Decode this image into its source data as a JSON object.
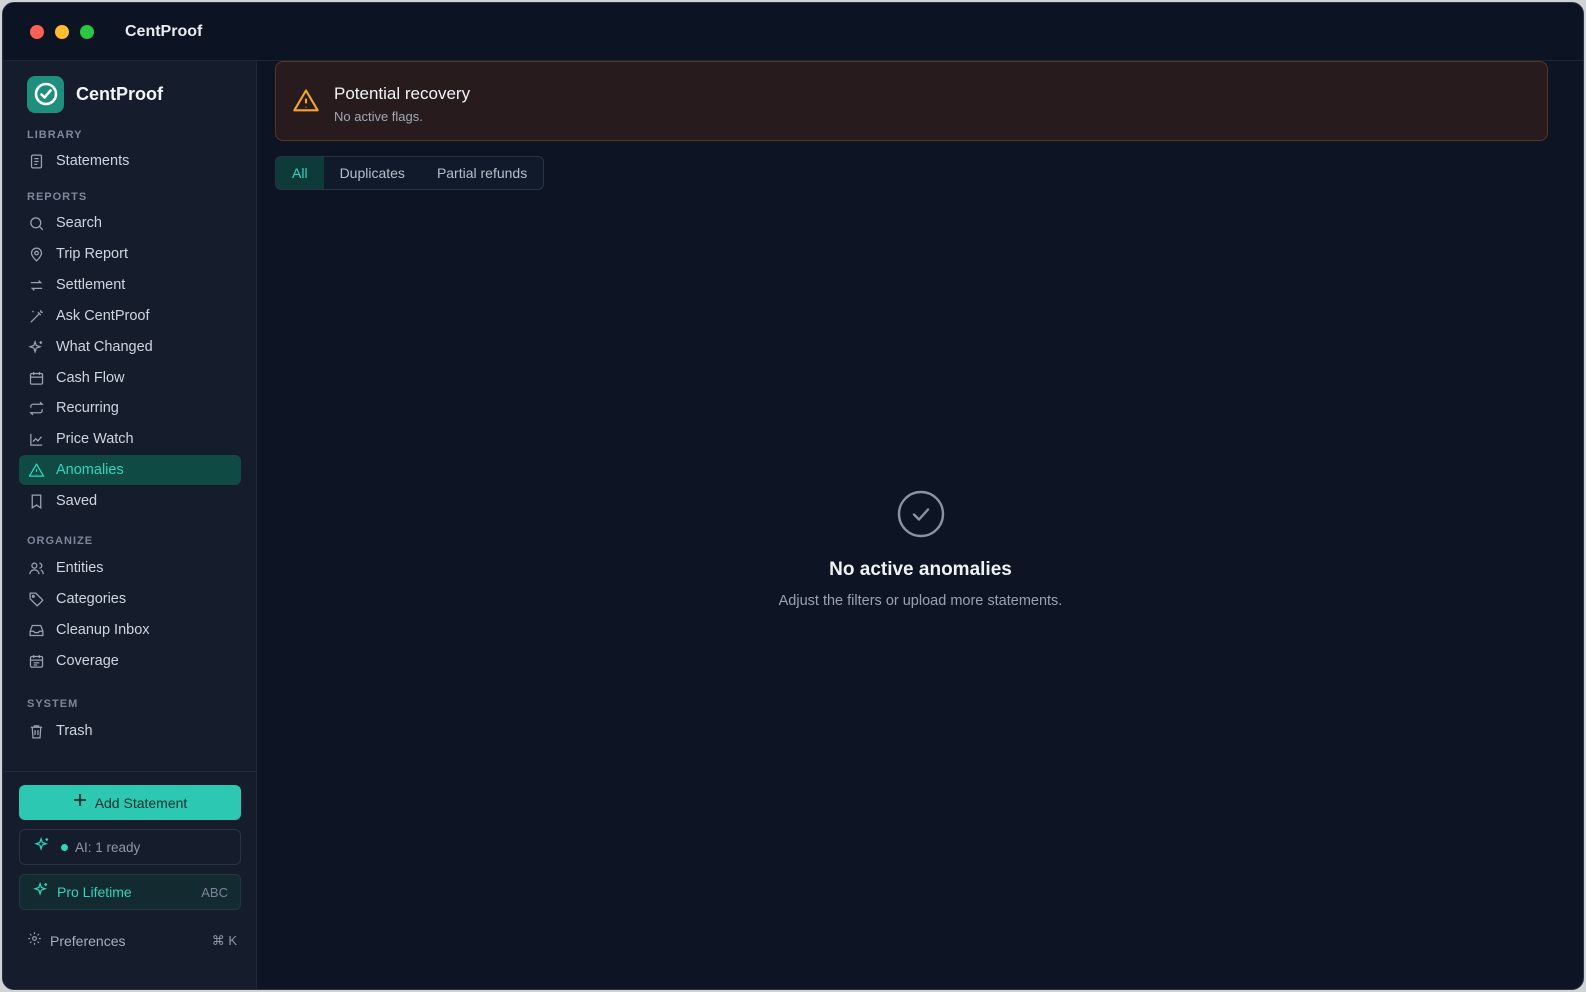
{
  "app": {
    "window_title": "CentProof",
    "brand_name": "CentProof"
  },
  "sidebar": {
    "sections": {
      "library": "LIBRARY",
      "reports": "REPORTS",
      "organize": "ORGANIZE",
      "system": "SYSTEM"
    },
    "items": [
      {
        "label": "Statements",
        "icon": "document-icon"
      },
      {
        "label": "Search",
        "icon": "search-icon"
      },
      {
        "label": "Trip Report",
        "icon": "map-pin-icon"
      },
      {
        "label": "Settlement",
        "icon": "arrows-swap-icon"
      },
      {
        "label": "Ask CentProof",
        "icon": "magic-wand-icon"
      },
      {
        "label": "What Changed",
        "icon": "sparkles-icon"
      },
      {
        "label": "Cash Flow",
        "icon": "calendar-icon"
      },
      {
        "label": "Recurring",
        "icon": "repeat-icon"
      },
      {
        "label": "Price Watch",
        "icon": "line-chart-icon"
      },
      {
        "label": "Anomalies",
        "icon": "warning-icon",
        "active": true
      },
      {
        "label": "Saved",
        "icon": "bookmark-icon"
      },
      {
        "label": "Entities",
        "icon": "users-icon"
      },
      {
        "label": "Categories",
        "icon": "tag-icon"
      },
      {
        "label": "Cleanup Inbox",
        "icon": "inbox-icon"
      },
      {
        "label": "Coverage",
        "icon": "calendar-check-icon"
      },
      {
        "label": "Trash",
        "icon": "trash-icon"
      }
    ],
    "add_statement": "Add Statement",
    "ai_status": "AI: 1 ready",
    "plan": {
      "label": "Pro Lifetime",
      "badge": "ABC"
    },
    "preferences": {
      "label": "Preferences",
      "shortcut": "⌘ K"
    }
  },
  "banner": {
    "title": "Potential recovery",
    "subtitle": "No active flags."
  },
  "tabs": [
    {
      "label": "All",
      "active": true
    },
    {
      "label": "Duplicates"
    },
    {
      "label": "Partial refunds"
    }
  ],
  "empty_state": {
    "title": "No active anomalies",
    "subtitle": "Adjust the filters or upload more statements."
  },
  "colors": {
    "accent": "#2fd6bd",
    "background": "#0d1424",
    "sidebar": "#151d2d",
    "warning": "#f5a623"
  }
}
